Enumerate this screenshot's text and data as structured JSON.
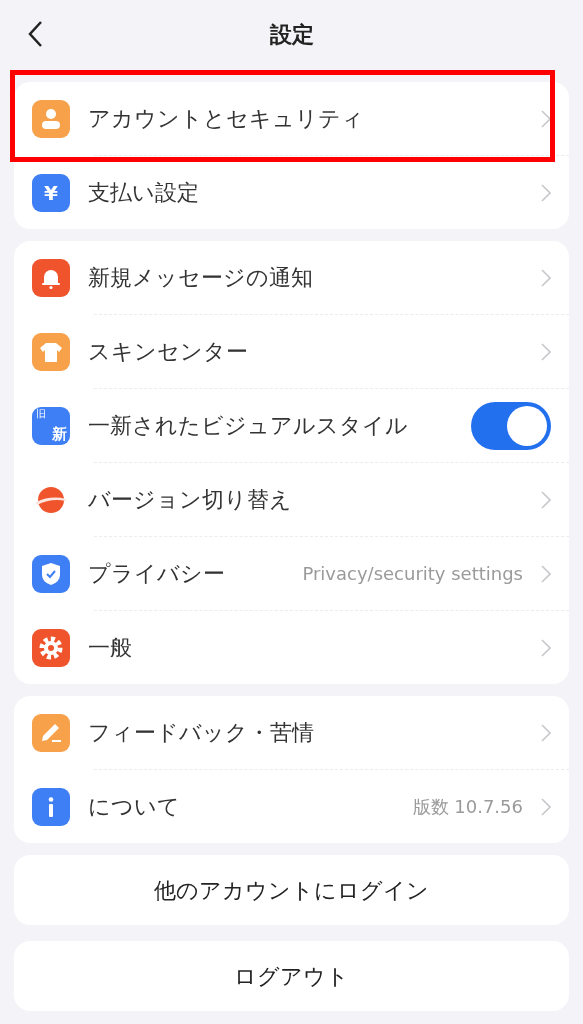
{
  "header": {
    "title": "設定"
  },
  "groups": [
    {
      "items": [
        {
          "label": "アカウントとセキュリティ",
          "kind": "link",
          "highlighted": true
        },
        {
          "icon_text": "¥",
          "label": "支払い設定",
          "kind": "link",
          "highlighted": false
        }
      ]
    },
    {
      "items": [
        {
          "label": "新規メッセージの通知",
          "kind": "link",
          "highlighted": false
        },
        {
          "label": "スキンセンター",
          "kind": "link",
          "highlighted": false
        },
        {
          "icon_text": "旧",
          "icon_text_2": "新",
          "label": "一新されたビジュアルスタイル",
          "kind": "toggle",
          "on": true,
          "highlighted": false
        },
        {
          "label": "バージョン切り替え",
          "kind": "link",
          "highlighted": false
        },
        {
          "label": "プライバシー",
          "value": "Privacy/security settings",
          "kind": "link",
          "highlighted": false
        },
        {
          "label": "一般",
          "kind": "link",
          "highlighted": false
        }
      ]
    },
    {
      "items": [
        {
          "label": "フィードバック・苦情",
          "kind": "link",
          "highlighted": false
        },
        {
          "label": "について",
          "value": "版数 10.7.56",
          "kind": "link",
          "highlighted": false
        }
      ]
    }
  ],
  "buttons": [
    "他のアカウントにログイン",
    "ログアウト"
  ]
}
